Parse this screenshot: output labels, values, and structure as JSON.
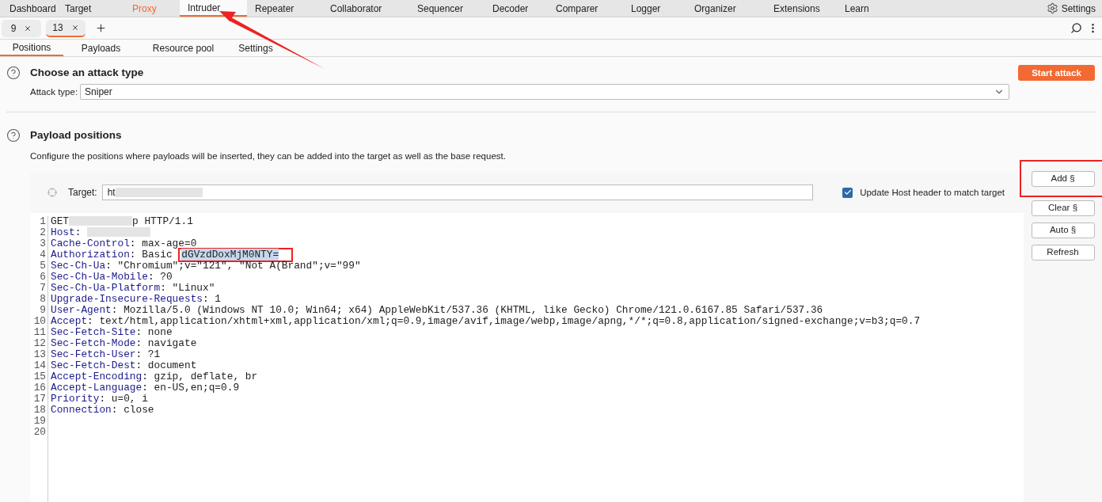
{
  "nav_tabs": [
    {
      "label": "Dashboard",
      "selected": false,
      "highlighted": false
    },
    {
      "label": "Target",
      "selected": false,
      "highlighted": false
    },
    {
      "label": "Proxy",
      "selected": false,
      "highlighted": true
    },
    {
      "label": "Intruder",
      "selected": true,
      "highlighted": false
    },
    {
      "label": "Repeater",
      "selected": false,
      "highlighted": false
    },
    {
      "label": "Collaborator",
      "selected": false,
      "highlighted": false
    },
    {
      "label": "Sequencer",
      "selected": false,
      "highlighted": false
    },
    {
      "label": "Decoder",
      "selected": false,
      "highlighted": false
    },
    {
      "label": "Comparer",
      "selected": false,
      "highlighted": false
    },
    {
      "label": "Logger",
      "selected": false,
      "highlighted": false
    },
    {
      "label": "Organizer",
      "selected": false,
      "highlighted": false
    },
    {
      "label": "Extensions",
      "selected": false,
      "highlighted": false
    },
    {
      "label": "Learn",
      "selected": false,
      "highlighted": false
    }
  ],
  "settings_label": "Settings",
  "request_tabs": [
    {
      "label": "9",
      "selected": false
    },
    {
      "label": "13",
      "selected": true
    }
  ],
  "sub_tabs": [
    {
      "label": "Positions",
      "selected": true
    },
    {
      "label": "Payloads",
      "selected": false
    },
    {
      "label": "Resource pool",
      "selected": false
    },
    {
      "label": "Settings",
      "selected": false
    }
  ],
  "attack_section": {
    "title": "Choose an attack type",
    "start_button": "Start attack",
    "attack_type_label": "Attack type:",
    "attack_type_value": "Sniper"
  },
  "payload_section": {
    "title": "Payload positions",
    "description": "Configure the positions where payloads will be inserted, they can be added into the target as well as the base request.",
    "target_label": "Target:",
    "target_value": "ht",
    "update_host": {
      "label": "Update Host header to match target",
      "checked": true
    },
    "buttons": [
      "Add §",
      "Clear §",
      "Auto §",
      "Refresh"
    ],
    "request_lines": [
      {
        "number": "1",
        "segments": [
          {
            "kind": "plain",
            "text": "GET"
          },
          {
            "kind": "redacted"
          },
          {
            "kind": "plain",
            "text": "p HTTP/1.1"
          }
        ]
      },
      {
        "number": "2",
        "segments": [
          {
            "kind": "header",
            "text": "Host"
          },
          {
            "kind": "plain",
            "text": ": "
          },
          {
            "kind": "redacted"
          }
        ]
      },
      {
        "number": "3",
        "segments": [
          {
            "kind": "header",
            "text": "Cache-Control"
          },
          {
            "kind": "plain",
            "text": ": max-age=0"
          }
        ]
      },
      {
        "number": "4",
        "segments": [
          {
            "kind": "header",
            "text": "Authorization"
          },
          {
            "kind": "plain",
            "text": ": Basic "
          },
          {
            "kind": "selected",
            "text": "dGVzdDoxMjM0NTY="
          }
        ]
      },
      {
        "number": "5",
        "segments": [
          {
            "kind": "header",
            "text": "Sec-Ch-Ua"
          },
          {
            "kind": "plain",
            "text": ": \"Chromium\";v=\"121\", \"Not A(Brand\";v=\"99\""
          }
        ]
      },
      {
        "number": "6",
        "segments": [
          {
            "kind": "header",
            "text": "Sec-Ch-Ua-Mobile"
          },
          {
            "kind": "plain",
            "text": ": ?0"
          }
        ]
      },
      {
        "number": "7",
        "segments": [
          {
            "kind": "header",
            "text": "Sec-Ch-Ua-Platform"
          },
          {
            "kind": "plain",
            "text": ": \"Linux\""
          }
        ]
      },
      {
        "number": "8",
        "segments": [
          {
            "kind": "header",
            "text": "Upgrade-Insecure-Requests"
          },
          {
            "kind": "plain",
            "text": ": 1"
          }
        ]
      },
      {
        "number": "9",
        "segments": [
          {
            "kind": "header",
            "text": "User-Agent"
          },
          {
            "kind": "plain",
            "text": ": Mozilla/5.0 (Windows NT 10.0; Win64; x64) AppleWebKit/537.36 (KHTML, like Gecko) Chrome/121.0.6167.85 Safari/537.36"
          }
        ]
      },
      {
        "number": "10",
        "segments": [
          {
            "kind": "header",
            "text": "Accept"
          },
          {
            "kind": "plain",
            "text": ": text/html,application/xhtml+xml,application/xml;q=0.9,image/avif,image/webp,image/apng,*/*;q=0.8,application/signed-exchange;v=b3;q=0.7"
          }
        ]
      },
      {
        "number": "11",
        "segments": [
          {
            "kind": "header",
            "text": "Sec-Fetch-Site"
          },
          {
            "kind": "plain",
            "text": ": none"
          }
        ]
      },
      {
        "number": "12",
        "segments": [
          {
            "kind": "header",
            "text": "Sec-Fetch-Mode"
          },
          {
            "kind": "plain",
            "text": ": navigate"
          }
        ]
      },
      {
        "number": "13",
        "segments": [
          {
            "kind": "header",
            "text": "Sec-Fetch-User"
          },
          {
            "kind": "plain",
            "text": ": ?1"
          }
        ]
      },
      {
        "number": "14",
        "segments": [
          {
            "kind": "header",
            "text": "Sec-Fetch-Dest"
          },
          {
            "kind": "plain",
            "text": ": document"
          }
        ]
      },
      {
        "number": "15",
        "segments": [
          {
            "kind": "header",
            "text": "Accept-Encoding"
          },
          {
            "kind": "plain",
            "text": ": gzip, deflate, br"
          }
        ]
      },
      {
        "number": "16",
        "segments": [
          {
            "kind": "header",
            "text": "Accept-Language"
          },
          {
            "kind": "plain",
            "text": ": en-US,en;q=0.9"
          }
        ]
      },
      {
        "number": "17",
        "segments": [
          {
            "kind": "header",
            "text": "Priority"
          },
          {
            "kind": "plain",
            "text": ": u=0, i"
          }
        ]
      },
      {
        "number": "18",
        "segments": [
          {
            "kind": "header",
            "text": "Connection"
          },
          {
            "kind": "plain",
            "text": ": close"
          }
        ]
      },
      {
        "number": "19"
      },
      {
        "number": "20"
      }
    ]
  }
}
